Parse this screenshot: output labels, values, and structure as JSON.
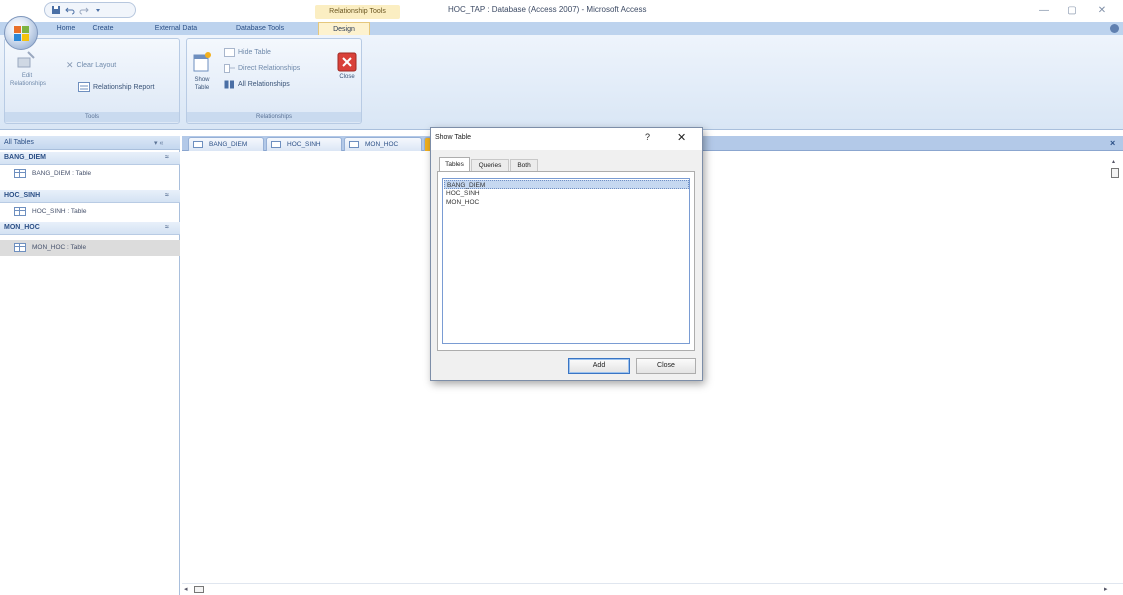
{
  "titlebar": {
    "quick_access": [
      "save-icon",
      "undo-icon",
      "redo-icon",
      "customize-icon"
    ],
    "contextual_group": "Relationship Tools",
    "app_title": "HOC_TAP : Database (Access 2007) - Microsoft Access",
    "minimize": "—",
    "maximize": "▢",
    "close": "✕"
  },
  "ribbon": {
    "tabs": [
      "Home",
      "Create",
      "External Data",
      "Database Tools",
      "Design"
    ],
    "active_tab": "Design",
    "groups": {
      "tools": {
        "label": "Tools",
        "edit_relationships": "Edit Relationships",
        "clear_layout": "Clear Layout",
        "relationship_report": "Relationship Report"
      },
      "relationships": {
        "label": "Relationships",
        "show_table": "Show Table",
        "hide_table": "Hide Table",
        "direct_relationships": "Direct Relationships",
        "all_relationships": "All Relationships",
        "close": "Close"
      }
    }
  },
  "nav": {
    "header": "All Tables",
    "header_controls": "▾ «",
    "groups": [
      {
        "name": "BANG_DIEM",
        "item": "BANG_DIEM : Table"
      },
      {
        "name": "HOC_SINH",
        "item": "HOC_SINH : Table"
      },
      {
        "name": "MON_HOC",
        "item": "MON_HOC : Table"
      }
    ],
    "group_chevron": "≈"
  },
  "doc_tabs": [
    "BANG_DIEM",
    "HOC_SINH",
    "MON_HOC"
  ],
  "doc_close": "×",
  "dialog": {
    "title": "Show Table",
    "help": "?",
    "close": "✕",
    "tabs": [
      "Tables",
      "Queries",
      "Both"
    ],
    "active_tab": "Tables",
    "items": [
      "BANG_DIEM",
      "HOC_SINH",
      "MON_HOC"
    ],
    "selected_item": "BANG_DIEM",
    "add_button": "Add",
    "close_button": "Close"
  },
  "colors": {
    "ribbon_tab_bar": "#bdd3ee",
    "contextual_tab": "#fbeec2",
    "selection": "#c5d8f1"
  }
}
